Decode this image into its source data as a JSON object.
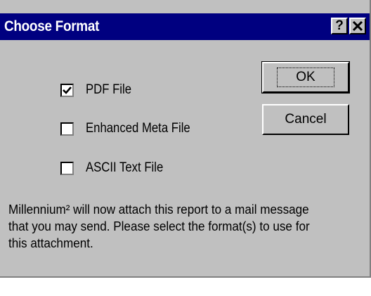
{
  "dialog": {
    "title": "Choose Format",
    "help_button_label": "?",
    "close_button_label": "✕"
  },
  "options": [
    {
      "label": "PDF File",
      "checked": true
    },
    {
      "label": "Enhanced Meta File",
      "checked": false
    },
    {
      "label": "ASCII Text File",
      "checked": false
    }
  ],
  "buttons": {
    "ok_label": "OK",
    "cancel_label": "Cancel"
  },
  "message": "Millennium² will now attach this report to a mail message that you may send.  Please select the format(s) to use for this attachment.",
  "colors": {
    "titlebar": "#000080",
    "face": "#c0c0c0"
  }
}
